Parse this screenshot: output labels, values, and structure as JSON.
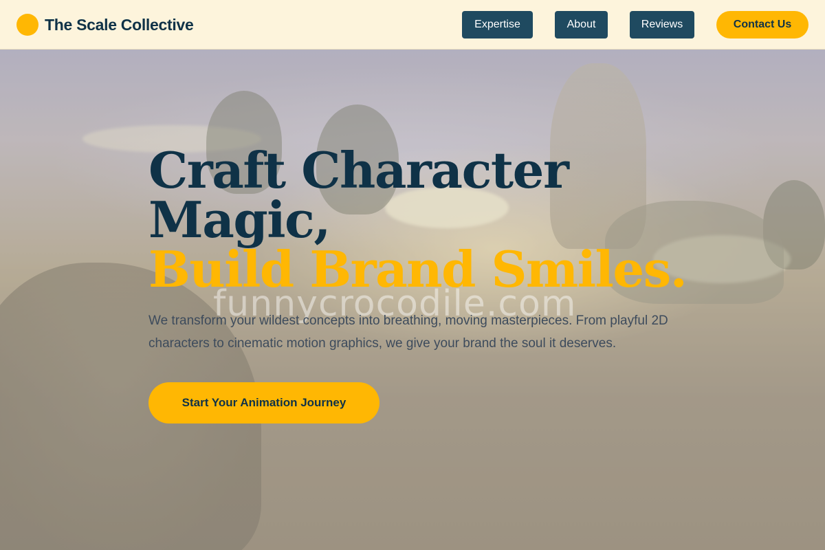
{
  "brand": {
    "name": "The Scale Collective",
    "accent_color": "#ffb703",
    "primary_color": "#0f3247"
  },
  "nav": {
    "items": [
      "Expertise",
      "About",
      "Reviews"
    ],
    "contact_label": "Contact Us"
  },
  "hero": {
    "line1": "Craft Character",
    "line2": "Magic,",
    "line3": "Build Brand Smiles.",
    "description": "We transform your wildest concepts into breathing, moving masterpieces. From playful 2D characters to cinematic motion graphics, we give your brand the soul it deserves.",
    "cta_label": "Start Your Animation Journey"
  },
  "watermark": "funnycrocodile.com"
}
